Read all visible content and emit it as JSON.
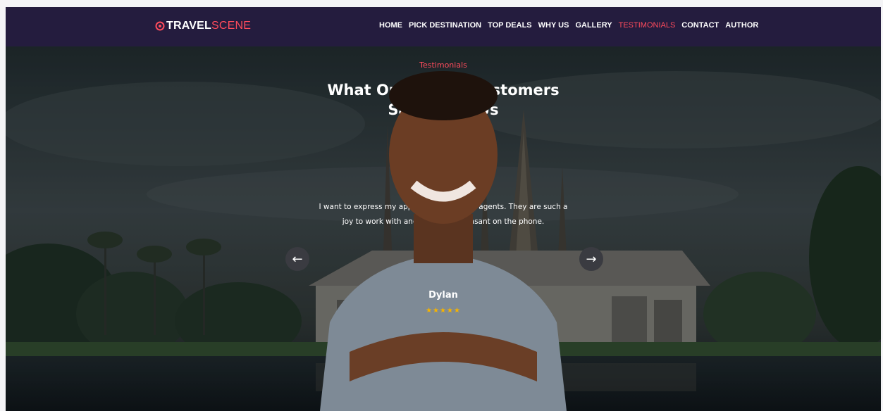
{
  "brand": {
    "part1": "TRAVEL",
    "part2": "SCENE"
  },
  "nav": {
    "items": [
      "HOME",
      "PICK DESTINATION",
      "TOP DEALS",
      "WHY US",
      "GALLERY",
      "TESTIMONIALS",
      "CONTACT",
      "AUTHOR"
    ],
    "active": "TESTIMONIALS"
  },
  "testimonials": {
    "eyebrow": "Testimonials",
    "heading_line1": "What Our Happy Customers",
    "heading_line2": "Say About Us",
    "quote_line1": "I want to express my appreciation for your agents. They are such a",
    "quote_line2": "joy to work with and always so pleasant on the phone.",
    "customer_name": "Dylan",
    "rating": 5,
    "stars": "★★★★★",
    "prev_icon": "arrow-left-icon",
    "next_icon": "arrow-right-icon",
    "prev_glyph": "←",
    "next_glyph": "→"
  },
  "colors": {
    "accent": "#ff4b5c",
    "navbar": "#241c3e",
    "star": "#f5b301"
  }
}
